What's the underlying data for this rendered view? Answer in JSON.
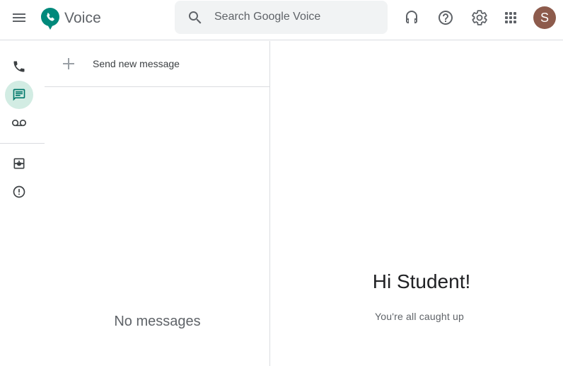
{
  "app": {
    "title": "Voice"
  },
  "search": {
    "placeholder": "Search Google Voice"
  },
  "header": {
    "icons": [
      "menu-icon",
      "voice-logo",
      "search-icon",
      "headset-icon",
      "help-icon",
      "gear-icon",
      "apps-icon"
    ],
    "avatar_initial": "S",
    "avatar_color": "#8d5b4c"
  },
  "nav": {
    "items": [
      {
        "name": "calls",
        "icon": "phone-icon",
        "active": false
      },
      {
        "name": "messages",
        "icon": "message-icon",
        "active": true
      },
      {
        "name": "voicemail",
        "icon": "voicemail-icon",
        "active": false
      },
      {
        "name": "archive",
        "icon": "archive-icon",
        "active": false
      },
      {
        "name": "spam",
        "icon": "spam-icon",
        "active": false
      }
    ],
    "active_color": "#d2ece3",
    "accent_color": "#00796b"
  },
  "list": {
    "send_new_label": "Send new message",
    "empty_label": "No messages"
  },
  "detail": {
    "greeting": "Hi Student!",
    "subtext": "You're all caught up"
  }
}
